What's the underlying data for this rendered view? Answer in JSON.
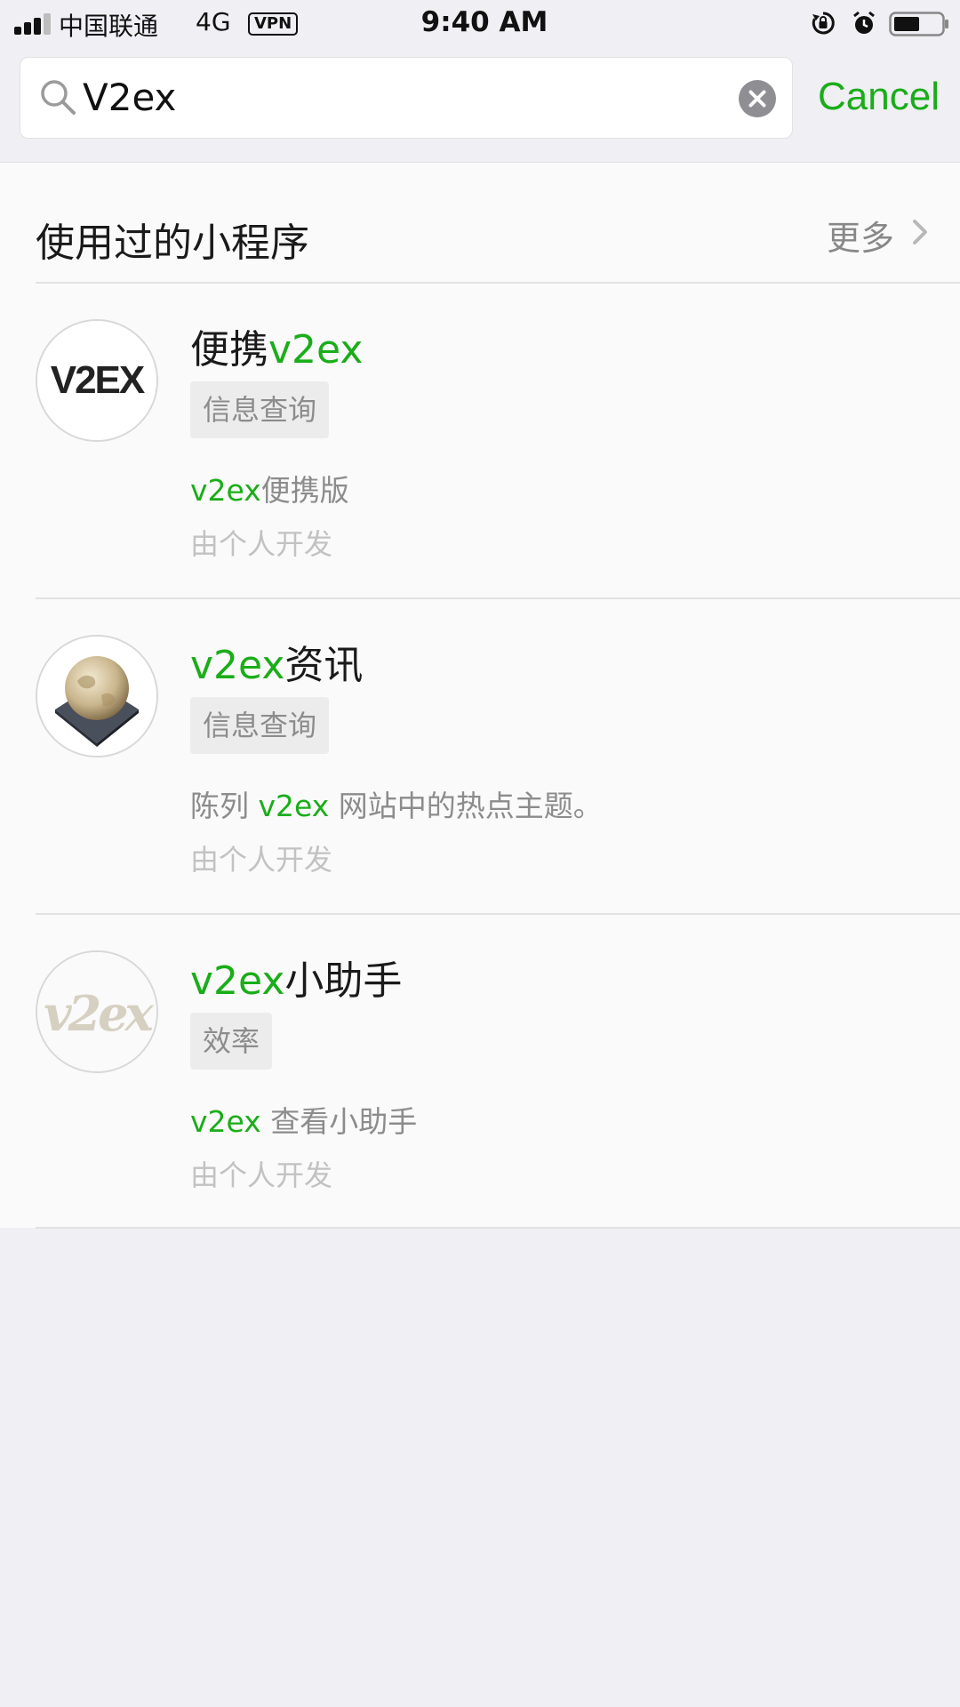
{
  "status_bar": {
    "carrier": "中国联通",
    "network": "4G",
    "vpn": "VPN",
    "time": "9:40 AM",
    "battery_level": 0.55
  },
  "search": {
    "value": "V2ex",
    "cancel_label": "Cancel"
  },
  "section": {
    "title": "使用过的小程序",
    "more_label": "更多"
  },
  "results": [
    {
      "title_plain": "便携",
      "title_highlight": "v2ex",
      "avatar_text": "V2EX",
      "tag": "信息查询",
      "desc_highlight": "v2ex",
      "desc_plain": "便携版",
      "developer": "由个人开发"
    },
    {
      "title_highlight": "v2ex",
      "title_plain": "资讯",
      "tag": "信息查询",
      "desc_prefix": "陈列 ",
      "desc_highlight": "v2ex",
      "desc_plain": " 网站中的热点主题。",
      "developer": "由个人开发"
    },
    {
      "title_highlight": "v2ex",
      "title_plain": "小助手",
      "avatar_text": "v2ex",
      "tag": "效率",
      "desc_highlight": "v2ex",
      "desc_plain": " 查看小助手",
      "developer": "由个人开发"
    }
  ],
  "colors": {
    "accent": "#1aad19",
    "background": "#efeff4"
  }
}
